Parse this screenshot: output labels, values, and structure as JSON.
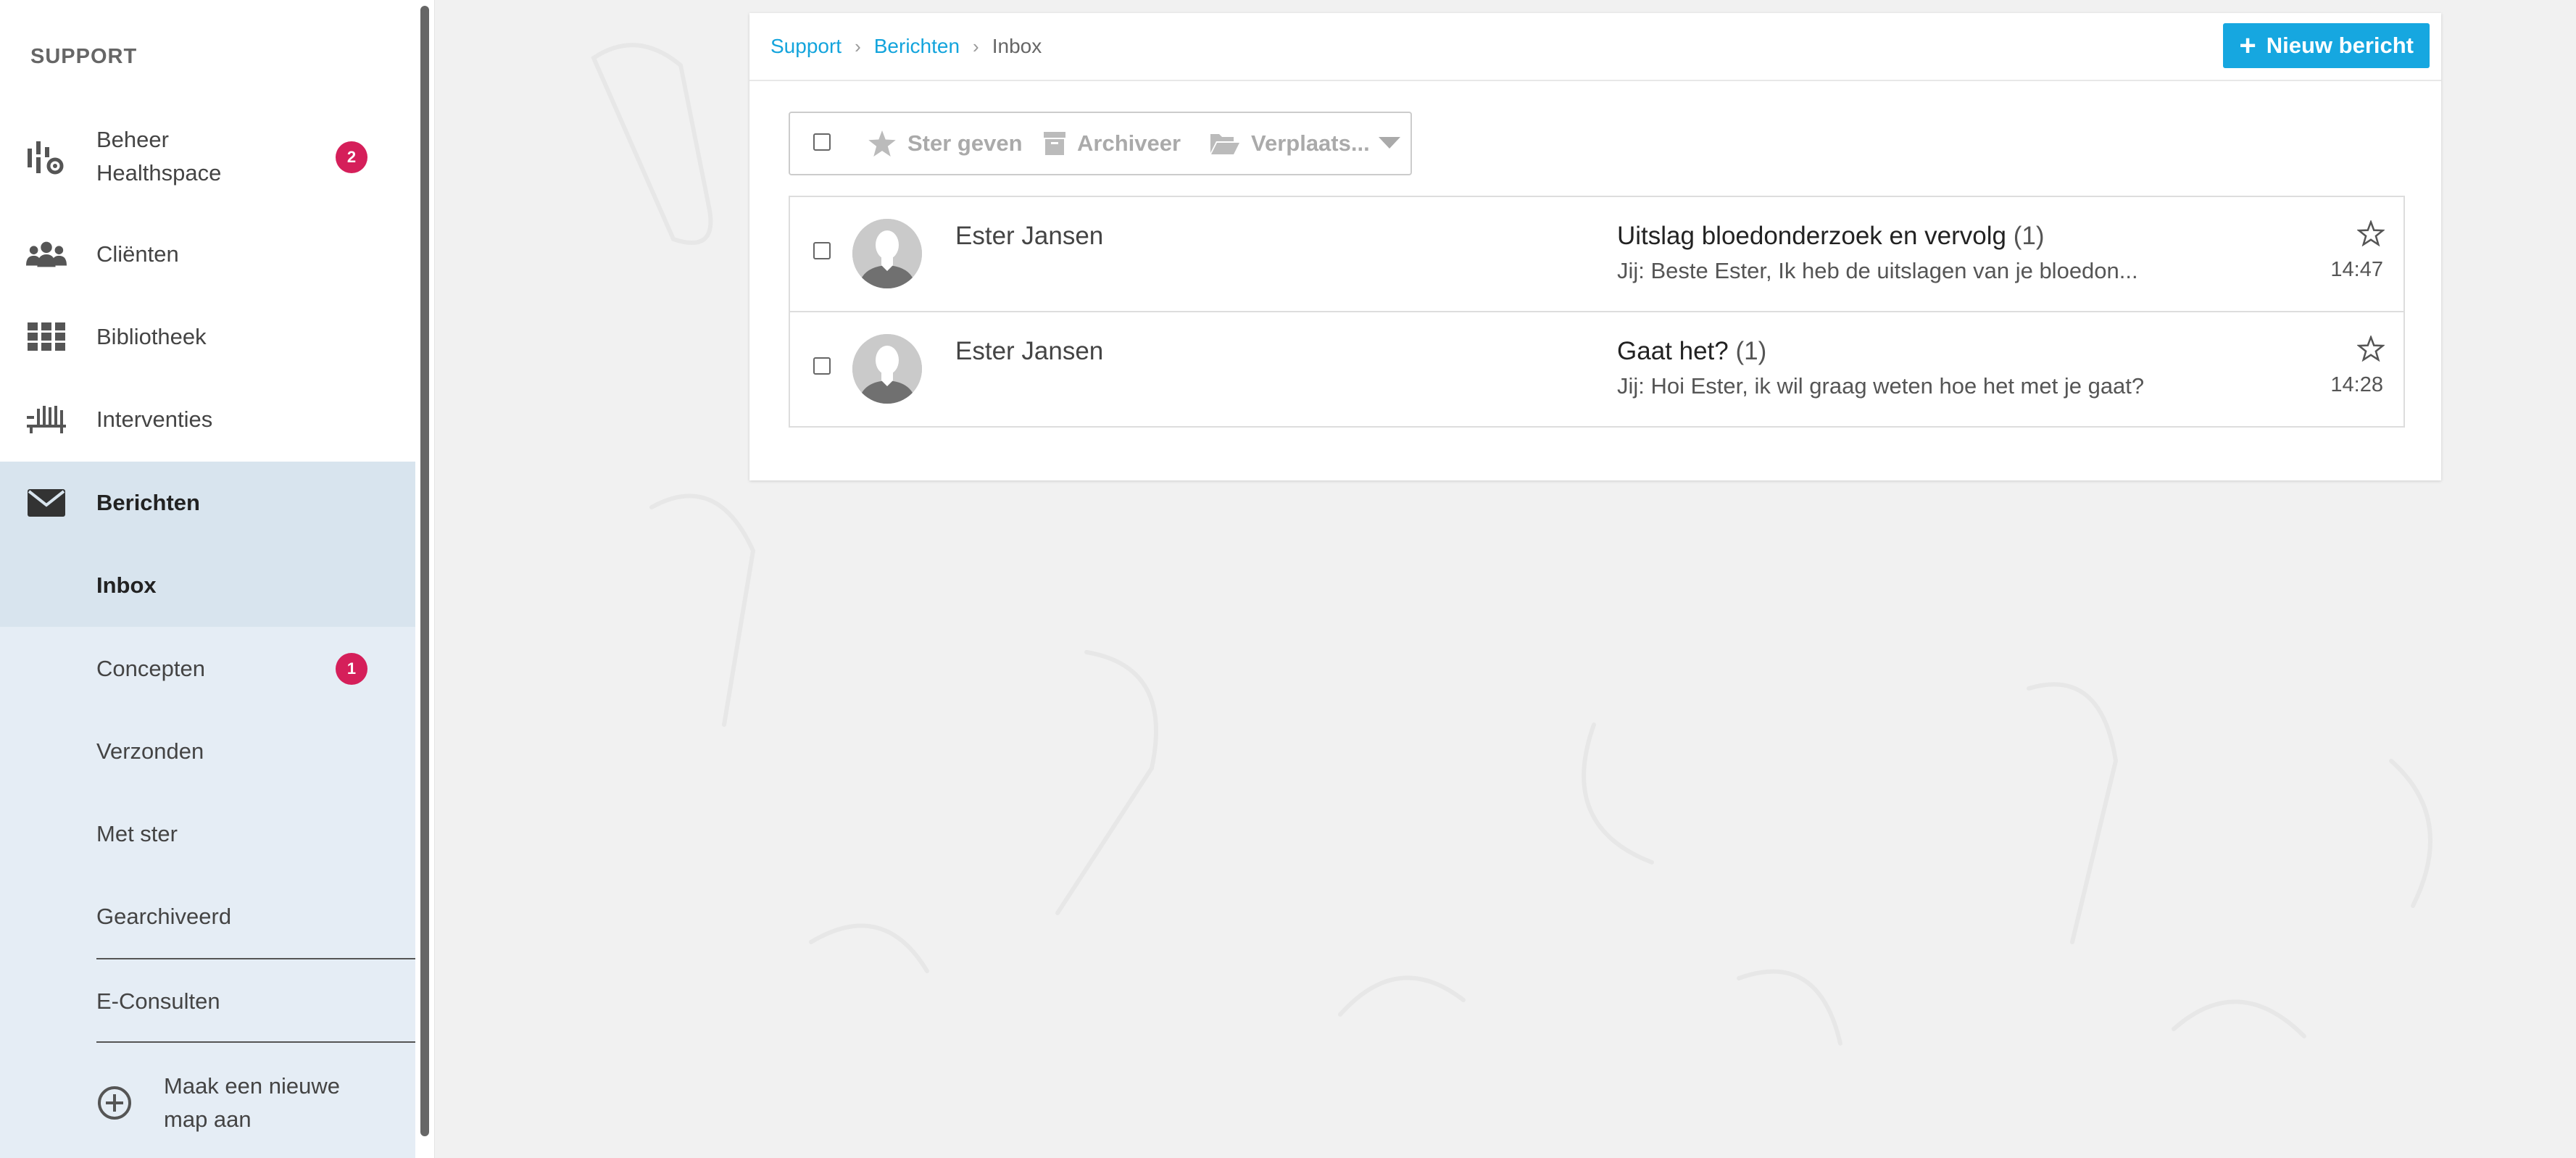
{
  "sidebar": {
    "title": "SUPPORT",
    "items": [
      {
        "label_line1": "Beheer",
        "label_line2": "Healthspace",
        "icon": "admin-gear-icon",
        "badge": "2"
      },
      {
        "label": "Cliënten",
        "icon": "users-icon"
      },
      {
        "label": "Bibliotheek",
        "icon": "grid-icon"
      },
      {
        "label": "Interventies",
        "icon": "interventions-icon"
      },
      {
        "label": "Berichten",
        "icon": "envelope-icon"
      }
    ],
    "sub_items": [
      {
        "label": "Inbox"
      },
      {
        "label": "Concepten",
        "badge": "1"
      },
      {
        "label": "Verzonden"
      },
      {
        "label": "Met ster"
      },
      {
        "label": "Gearchiveerd"
      },
      {
        "label": "E-Consulten"
      }
    ],
    "new_folder": {
      "line1": "Maak een nieuwe",
      "line2": "map aan",
      "icon": "plus-circle-icon"
    }
  },
  "breadcrumb": {
    "items": [
      "Support",
      "Berichten"
    ],
    "current": "Inbox"
  },
  "new_message_button": {
    "label": "Nieuw bericht",
    "icon": "plus-icon"
  },
  "toolbar": {
    "star_label": "Ster geven",
    "archive_label": "Archiveer",
    "move_label": "Verplaats..."
  },
  "messages": [
    {
      "sender": "Ester Jansen",
      "subject": "Uitslag bloedonderzoek en vervolg",
      "count": "(1)",
      "preview": "Jij: Beste Ester, Ik heb de uitslagen van je bloedon...",
      "time": "14:47"
    },
    {
      "sender": "Ester Jansen",
      "subject": "Gaat het?",
      "count": "(1)",
      "preview": "Jij: Hoi Ester, ik wil graag weten hoe het met je gaat?",
      "time": "14:28"
    }
  ],
  "colors": {
    "accent": "#16a7e0",
    "badge": "#d51f5a",
    "active_bg": "#d8e4ee",
    "sub_bg": "#e5edf5"
  }
}
